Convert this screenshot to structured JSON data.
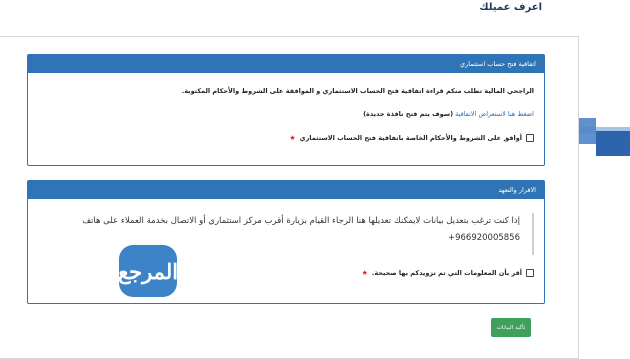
{
  "page": {
    "title": "اعرف عميلك"
  },
  "panel_agreement": {
    "header": "اتفاقية فتح حساب استثماري",
    "info": "الراجحي المالية تطلب منكم قراءة اتفاقية فتح الحساب الاستثماري و الموافقة على الشروط والأحكام المكتوبة.",
    "link_label": "اضغط هنا لاستعراض الاتفاقية",
    "link_note": "(سوف يتم فتح نافذة جديدة)",
    "checkbox_label": "أوافق على الشروط والأحكام الخاصة باتفاقية فتح الحساب الاستثماري",
    "required_mark": "★"
  },
  "panel_declaration": {
    "header": "الاقرار والتعهد",
    "body": "إذا كنت ترغب بتعديل بيانات لايمكنك تعديلها هنا الرجاء القيام بزيارة أقرب مركز استثماري أو الاتصال بخدمة العملاء على هاتف",
    "phone": "+966920005856",
    "checkbox_label": "أقر بأن المعلومات التي تم تزويدكم بها صحيحة.",
    "required_mark": "★"
  },
  "actions": {
    "confirm_label": "تأكيد البيانات"
  },
  "watermark": {
    "text": "المرجع"
  },
  "colors": {
    "panel_header": "#2f74b5",
    "confirm_button": "#3ea05a",
    "required": "#d9242b"
  }
}
